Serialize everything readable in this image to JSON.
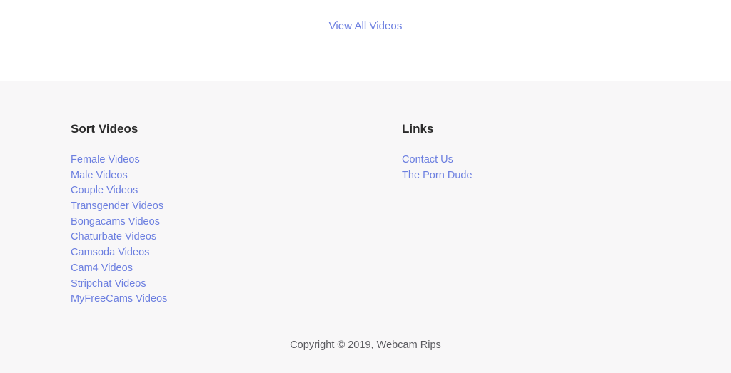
{
  "theme": {
    "link_color": "#6c7fe0",
    "heading_color": "#2b2b2b",
    "footer_background": "#f8f7f8",
    "page_background": "#ffffff",
    "copyright_color": "#5a5a5f"
  },
  "top": {
    "view_all_label": "View All Videos"
  },
  "footer": {
    "columns": [
      {
        "id": "sort-videos",
        "title": "Sort Videos",
        "links": [
          {
            "label": "Female Videos"
          },
          {
            "label": "Male Videos"
          },
          {
            "label": "Couple Videos"
          },
          {
            "label": "Transgender Videos"
          },
          {
            "label": "Bongacams Videos"
          },
          {
            "label": "Chaturbate Videos"
          },
          {
            "label": "Camsoda Videos"
          },
          {
            "label": "Cam4 Videos"
          },
          {
            "label": "Stripchat Videos"
          },
          {
            "label": "MyFreeCams Videos"
          }
        ]
      },
      {
        "id": "links",
        "title": "Links",
        "links": [
          {
            "label": "Contact Us"
          },
          {
            "label": "The Porn Dude"
          }
        ]
      }
    ],
    "copyright": "Copyright © 2019, Webcam Rips"
  }
}
